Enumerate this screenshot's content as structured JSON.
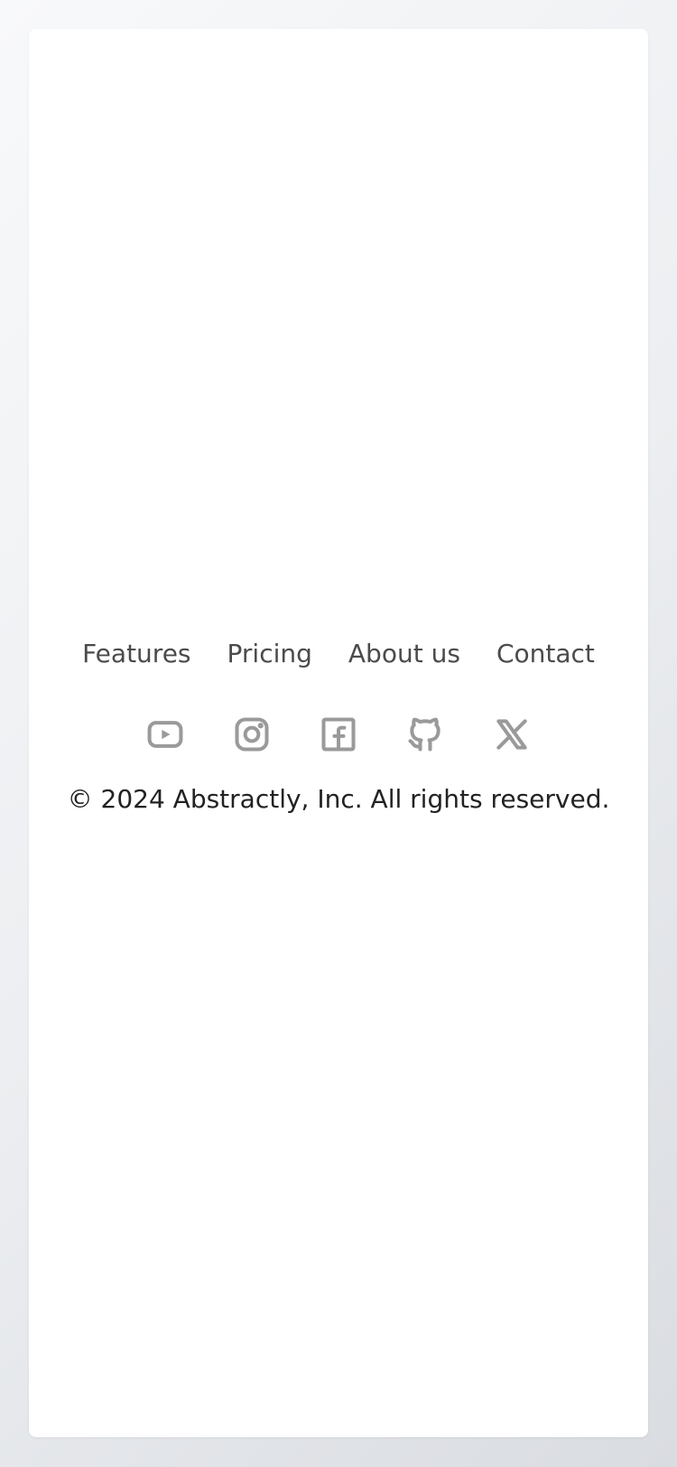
{
  "footer": {
    "nav": [
      {
        "label": "Features"
      },
      {
        "label": "Pricing"
      },
      {
        "label": "About us"
      },
      {
        "label": "Contact"
      }
    ],
    "social_icons": [
      "youtube-icon",
      "instagram-icon",
      "facebook-icon",
      "github-icon",
      "x-icon"
    ],
    "copyright": "© 2024 Abstractly, Inc. All rights reserved."
  },
  "colors": {
    "nav_text": "#4b4b4b",
    "icon": "#9a9a9a",
    "copyright_text": "#222222",
    "card_bg": "#ffffff"
  }
}
